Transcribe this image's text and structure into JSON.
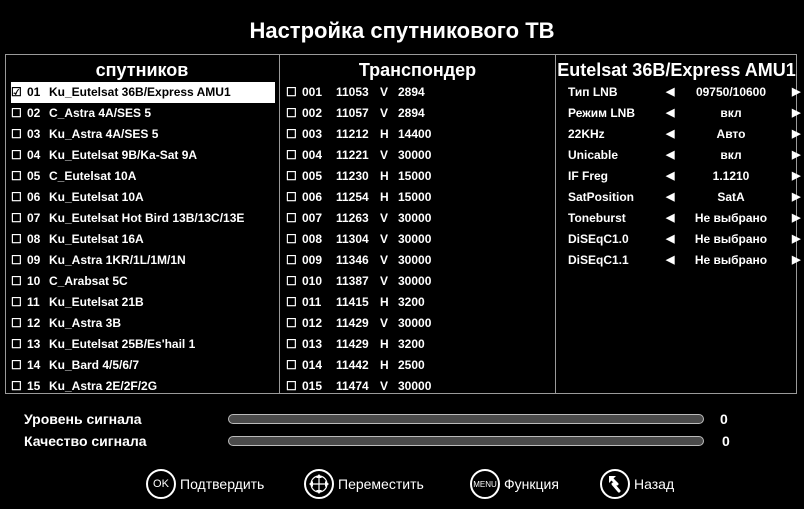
{
  "title": "Настройка спутникового ТВ",
  "satellites": {
    "header": "спутников",
    "items": [
      {
        "check": "☑",
        "num": "01",
        "name": "Ku_Eutelsat 36B/Express AMU1"
      },
      {
        "check": "☐",
        "num": "02",
        "name": "C_Astra 4A/SES 5"
      },
      {
        "check": "☐",
        "num": "03",
        "name": "Ku_Astra 4A/SES 5"
      },
      {
        "check": "☐",
        "num": "04",
        "name": "Ku_Eutelsat 9B/Ka-Sat 9A"
      },
      {
        "check": "☐",
        "num": "05",
        "name": "C_Eutelsat 10A"
      },
      {
        "check": "☐",
        "num": "06",
        "name": "Ku_Eutelsat 10A"
      },
      {
        "check": "☐",
        "num": "07",
        "name": "Ku_Eutelsat Hot Bird 13B/13C/13E"
      },
      {
        "check": "☐",
        "num": "08",
        "name": "Ku_Eutelsat 16A"
      },
      {
        "check": "☐",
        "num": "09",
        "name": "Ku_Astra 1KR/1L/1M/1N"
      },
      {
        "check": "☐",
        "num": "10",
        "name": "C_Arabsat 5C"
      },
      {
        "check": "☐",
        "num": "11",
        "name": "Ku_Eutelsat 21B"
      },
      {
        "check": "☐",
        "num": "12",
        "name": "Ku_Astra 3B"
      },
      {
        "check": "☐",
        "num": "13",
        "name": "Ku_Eutelsat 25B/Es'hail 1"
      },
      {
        "check": "☐",
        "num": "14",
        "name": "Ku_Bard 4/5/6/7"
      },
      {
        "check": "☐",
        "num": "15",
        "name": "Ku_Astra 2E/2F/2G"
      }
    ]
  },
  "transponders": {
    "header": "Транспондер",
    "items": [
      {
        "check": "☐",
        "num": "001",
        "freq": "11053",
        "pol": "V",
        "sr": "2894"
      },
      {
        "check": "☐",
        "num": "002",
        "freq": "11057",
        "pol": "V",
        "sr": "2894"
      },
      {
        "check": "☐",
        "num": "003",
        "freq": "11212",
        "pol": "H",
        "sr": "14400"
      },
      {
        "check": "☐",
        "num": "004",
        "freq": "11221",
        "pol": "V",
        "sr": "30000"
      },
      {
        "check": "☐",
        "num": "005",
        "freq": "11230",
        "pol": "H",
        "sr": "15000"
      },
      {
        "check": "☐",
        "num": "006",
        "freq": "11254",
        "pol": "H",
        "sr": "15000"
      },
      {
        "check": "☐",
        "num": "007",
        "freq": "11263",
        "pol": "V",
        "sr": "30000"
      },
      {
        "check": "☐",
        "num": "008",
        "freq": "11304",
        "pol": "V",
        "sr": "30000"
      },
      {
        "check": "☐",
        "num": "009",
        "freq": "11346",
        "pol": "V",
        "sr": "30000"
      },
      {
        "check": "☐",
        "num": "010",
        "freq": "11387",
        "pol": "V",
        "sr": "30000"
      },
      {
        "check": "☐",
        "num": "011",
        "freq": "11415",
        "pol": "H",
        "sr": "3200"
      },
      {
        "check": "☐",
        "num": "012",
        "freq": "11429",
        "pol": "V",
        "sr": "30000"
      },
      {
        "check": "☐",
        "num": "013",
        "freq": "11429",
        "pol": "H",
        "sr": "3200"
      },
      {
        "check": "☐",
        "num": "014",
        "freq": "11442",
        "pol": "H",
        "sr": "2500"
      },
      {
        "check": "☐",
        "num": "015",
        "freq": "11474",
        "pol": "V",
        "sr": "30000"
      }
    ]
  },
  "settings": {
    "header": "Eutelsat 36B/Express AMU1",
    "arrow_left": "◀",
    "arrow_right": "▶",
    "items": [
      {
        "label": "Тип LNB",
        "value": "09750/10600"
      },
      {
        "label": "Режим LNB",
        "value": "вкл"
      },
      {
        "label": "22KHz",
        "value": "Авто"
      },
      {
        "label": "Unicable",
        "value": "вкл"
      },
      {
        "label": "IF Freg",
        "value": "1.1210"
      },
      {
        "label": "SatPosition",
        "value": "SatA"
      },
      {
        "label": "Toneburst",
        "value": "Не выбрано"
      },
      {
        "label": "DiSEqC1.0",
        "value": "Не выбрано"
      },
      {
        "label": "DiSEqC1.1",
        "value": "Не выбрано"
      }
    ]
  },
  "signal": {
    "level_label": "Уровень сигнала",
    "level_value": "0",
    "level_fraction": 0,
    "quality_label": "Качество сигнала",
    "quality_value": "0",
    "quality_fraction": 0
  },
  "footer": {
    "ok_icon_text": "OK",
    "ok_label": "Подтвердить",
    "move_label": "Переместить",
    "menu_icon_text": "MENU",
    "menu_label": "Функция",
    "back_label": "Назад"
  },
  "icons": {
    "ok": "ok-icon",
    "move": "dpad-icon",
    "menu": "menu-icon",
    "back": "back-icon"
  }
}
